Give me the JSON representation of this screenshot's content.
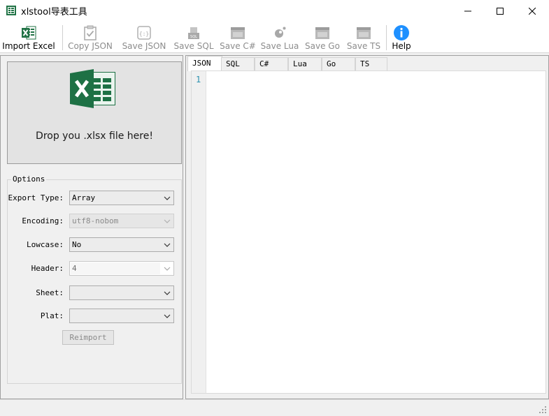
{
  "window": {
    "title": "xlstool导表工具"
  },
  "toolbar": {
    "items": [
      {
        "label": "Import Excel",
        "icon": "excel-icon",
        "enabled": true
      },
      {
        "label": "Copy JSON",
        "icon": "clipboard-check-icon",
        "enabled": false
      },
      {
        "label": "Save JSON",
        "icon": "json-file-icon",
        "enabled": false
      },
      {
        "label": "Save SQL",
        "icon": "sql-file-icon",
        "enabled": false
      },
      {
        "label": "Save C#",
        "icon": "csharp-file-icon",
        "enabled": false
      },
      {
        "label": "Save Lua",
        "icon": "lua-icon",
        "enabled": false
      },
      {
        "label": "Save Go",
        "icon": "go-file-icon",
        "enabled": false
      },
      {
        "label": "Save TS",
        "icon": "ts-file-icon",
        "enabled": false
      },
      {
        "label": "Help",
        "icon": "info-icon",
        "enabled": true
      }
    ]
  },
  "dropzone": {
    "text": "Drop you .xlsx file here!"
  },
  "options": {
    "legend": "Options",
    "export_type": {
      "label": "Export Type:",
      "value": "Array"
    },
    "encoding": {
      "label": "Encoding:",
      "value": "utf8-nobom"
    },
    "lowcase": {
      "label": "Lowcase:",
      "value": "No"
    },
    "header": {
      "label": "Header:",
      "value": "4"
    },
    "sheet": {
      "label": "Sheet:",
      "value": ""
    },
    "plat": {
      "label": "Plat:",
      "value": ""
    },
    "reimport_label": "Reimport"
  },
  "tabs": [
    "JSON",
    "SQL",
    "C#",
    "Lua",
    "Go",
    "TS"
  ],
  "editor": {
    "line_numbers": [
      "1"
    ]
  },
  "colors": {
    "excel_green": "#217346",
    "help_blue": "#1e90ff",
    "line_number": "#2b91af"
  }
}
